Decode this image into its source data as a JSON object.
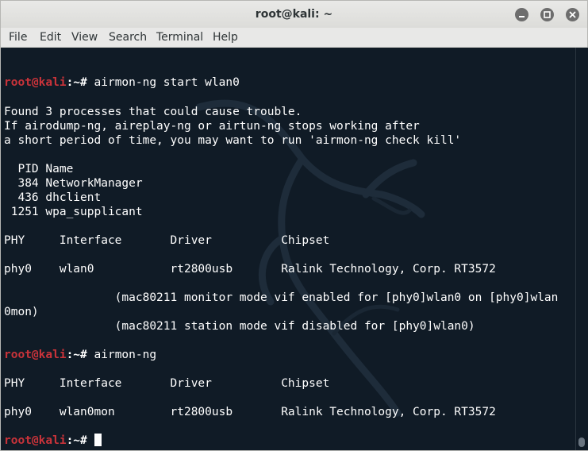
{
  "window": {
    "title": "root@kali: ~"
  },
  "menu": [
    "File",
    "Edit",
    "View",
    "Search",
    "Terminal",
    "Help"
  ],
  "window_buttons": [
    "minimize-icon",
    "maximize-icon",
    "close-icon"
  ],
  "prompt": {
    "user_host": "root@kali",
    "path_symbol": ":~# "
  },
  "terminal": {
    "cmd1": "airmon-ng start wlan0",
    "found": "Found 3 processes that could cause trouble.",
    "if_line": "If airodump-ng, aireplay-ng or airtun-ng stops working after",
    "short_line": "a short period of time, you may want to run 'airmon-ng check kill'",
    "proc_header": "  PID Name",
    "proc1": "  384 NetworkManager",
    "proc2": "  436 dhclient",
    "proc3": " 1251 wpa_supplicant",
    "table_header": "PHY     Interface       Driver          Chipset",
    "row1": "phy0    wlan0           rt2800usb       Ralink Technology, Corp. RT3572",
    "mon_line1": "                (mac80211 monitor mode vif enabled for [phy0]wlan0 on [phy0]wlan",
    "mon_line2": "0mon)",
    "sta_line": "                (mac80211 station mode vif disabled for [phy0]wlan0)",
    "cmd2": "airmon-ng",
    "table_header2": "PHY     Interface       Driver          Chipset",
    "row2": "phy0    wlan0mon        rt2800usb       Ralink Technology, Corp. RT3572"
  },
  "colors": {
    "terminal_bg": "#101b26",
    "prompt_user": "#c9333a",
    "text": "#ffffff"
  }
}
